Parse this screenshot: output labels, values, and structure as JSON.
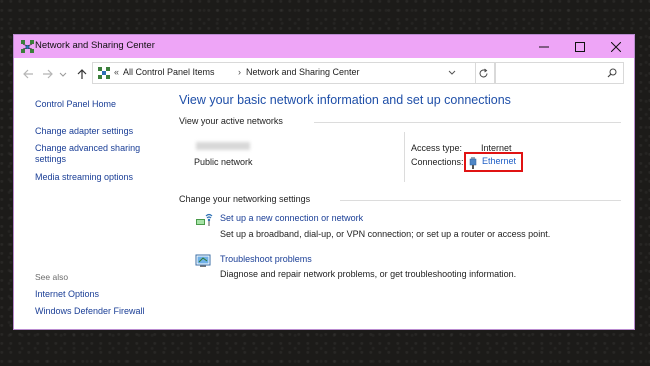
{
  "window": {
    "title": "Network and Sharing Center"
  },
  "breadcrumb": {
    "overflow": "«",
    "items": [
      "All Control Panel Items",
      "Network and Sharing Center"
    ],
    "separator": "›"
  },
  "search": {
    "placeholder": ""
  },
  "sidebar": {
    "links": [
      "Control Panel Home",
      "Change adapter settings",
      "Change advanced sharing settings",
      "Media streaming options"
    ],
    "see_also": {
      "label": "See also",
      "links": [
        "Internet Options",
        "Windows Defender Firewall"
      ]
    }
  },
  "main": {
    "title": "View your basic network information and set up connections",
    "active_networks": {
      "label": "View your active networks",
      "network_type": "Public network",
      "access_type_label": "Access type:",
      "access_type_value": "Internet",
      "connections_label": "Connections:",
      "connection_name": "Ethernet"
    },
    "change_settings": {
      "label": "Change your networking settings",
      "tasks": [
        {
          "link": "Set up a new connection or network",
          "description": "Set up a broadband, dial-up, or VPN connection; or set up a router or access point.",
          "icon": "new-connection-icon"
        },
        {
          "link": "Troubleshoot problems",
          "description": "Diagnose and repair network problems, or get troubleshooting information.",
          "icon": "troubleshoot-icon"
        }
      ]
    }
  },
  "colors": {
    "titlebar": "#eea5f7",
    "link": "#1a3e96",
    "heading": "#1f4fa8",
    "highlight": "#e01313"
  }
}
